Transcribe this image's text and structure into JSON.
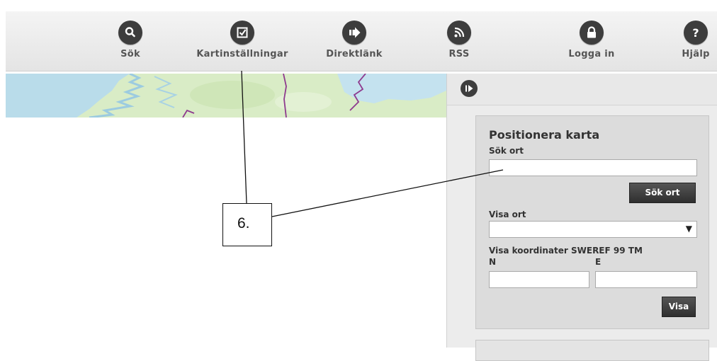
{
  "toolbar": {
    "items": [
      {
        "label": "Sök",
        "icon": "search-icon"
      },
      {
        "label": "Kartinställningar",
        "icon": "map-settings-icon"
      },
      {
        "label": "Direktlänk",
        "icon": "direct-link-icon"
      },
      {
        "label": "RSS",
        "icon": "rss-icon"
      },
      {
        "label": "Logga in",
        "icon": "lock-icon"
      },
      {
        "label": "Hjälp",
        "icon": "help-icon"
      }
    ]
  },
  "side_panel": {
    "collapse_icon": "collapse-panel-icon",
    "position_map": {
      "title": "Positionera karta",
      "search_place_label": "Sök ort",
      "search_place_value": "",
      "search_place_button": "Sök ort",
      "show_place_label": "Visa ort",
      "show_place_selected": "",
      "coordinates_label": "Visa koordinater SWEREF 99 TM",
      "north_label": "N",
      "north_value": "",
      "east_label": "E",
      "east_value": "",
      "show_button": "Visa"
    }
  },
  "annotation": {
    "callout_label": "6."
  },
  "colors": {
    "icon_circle": "#3d3d3d",
    "button": "#3a3a3a",
    "panel_bg": "#ececec",
    "map_water": "#b9dcea",
    "map_land": "#d8ecc4",
    "map_border": "#8e3a8e"
  }
}
